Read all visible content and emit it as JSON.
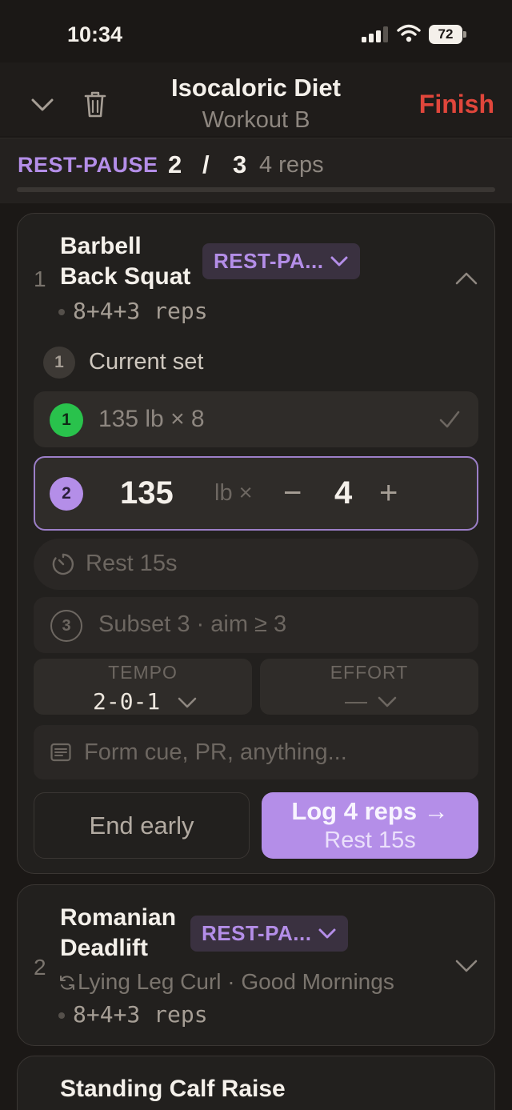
{
  "status_bar": {
    "time": "10:34",
    "battery": "72"
  },
  "header": {
    "title": "Isocaloric Diet",
    "subtitle": "Workout B",
    "finish_label": "Finish"
  },
  "rest_pause_bar": {
    "label": "REST-PAUSE",
    "current": "2",
    "separator": "/",
    "total": "3",
    "reps": "4 reps",
    "progress": 0
  },
  "exercises": [
    {
      "index": "1",
      "name_line1": "Barbell",
      "name_line2": "Back Squat",
      "mode_chip": "REST-PA...",
      "reps_scheme": "8+4+3 reps",
      "current_set_badge": "1",
      "current_set_label": "Current set",
      "completed_set": {
        "number": "1",
        "text": "135 lb × 8"
      },
      "active_set": {
        "number": "2",
        "weight": "135",
        "unit": "lb ×",
        "minus": "−",
        "reps": "4",
        "plus": "+"
      },
      "rest": "Rest 15s",
      "upcoming_subset": {
        "number": "3",
        "text": "Subset 3 · aim ≥ 3"
      },
      "tempo": {
        "label": "TEMPO",
        "value": "2-0-1"
      },
      "effort": {
        "label": "EFFORT",
        "value": "—"
      },
      "note_placeholder": "Form cue, PR, anything...",
      "end_early_label": "End early",
      "log_label": "Log 4 reps →",
      "log_sublabel": "Rest 15s"
    },
    {
      "index": "2",
      "name_line1": "Romanian",
      "name_line2": "Deadlift",
      "mode_chip": "REST-PA...",
      "alternatives": "Lying Leg Curl · Good Mornings",
      "reps_scheme": "8+4+3 reps"
    },
    {
      "name": "Standing Calf Raise"
    }
  ],
  "colors": {
    "accent": "#b48ee8",
    "finish": "#e0463b",
    "done": "#29c24c",
    "background": "#1b1816",
    "card": "#22201e"
  }
}
